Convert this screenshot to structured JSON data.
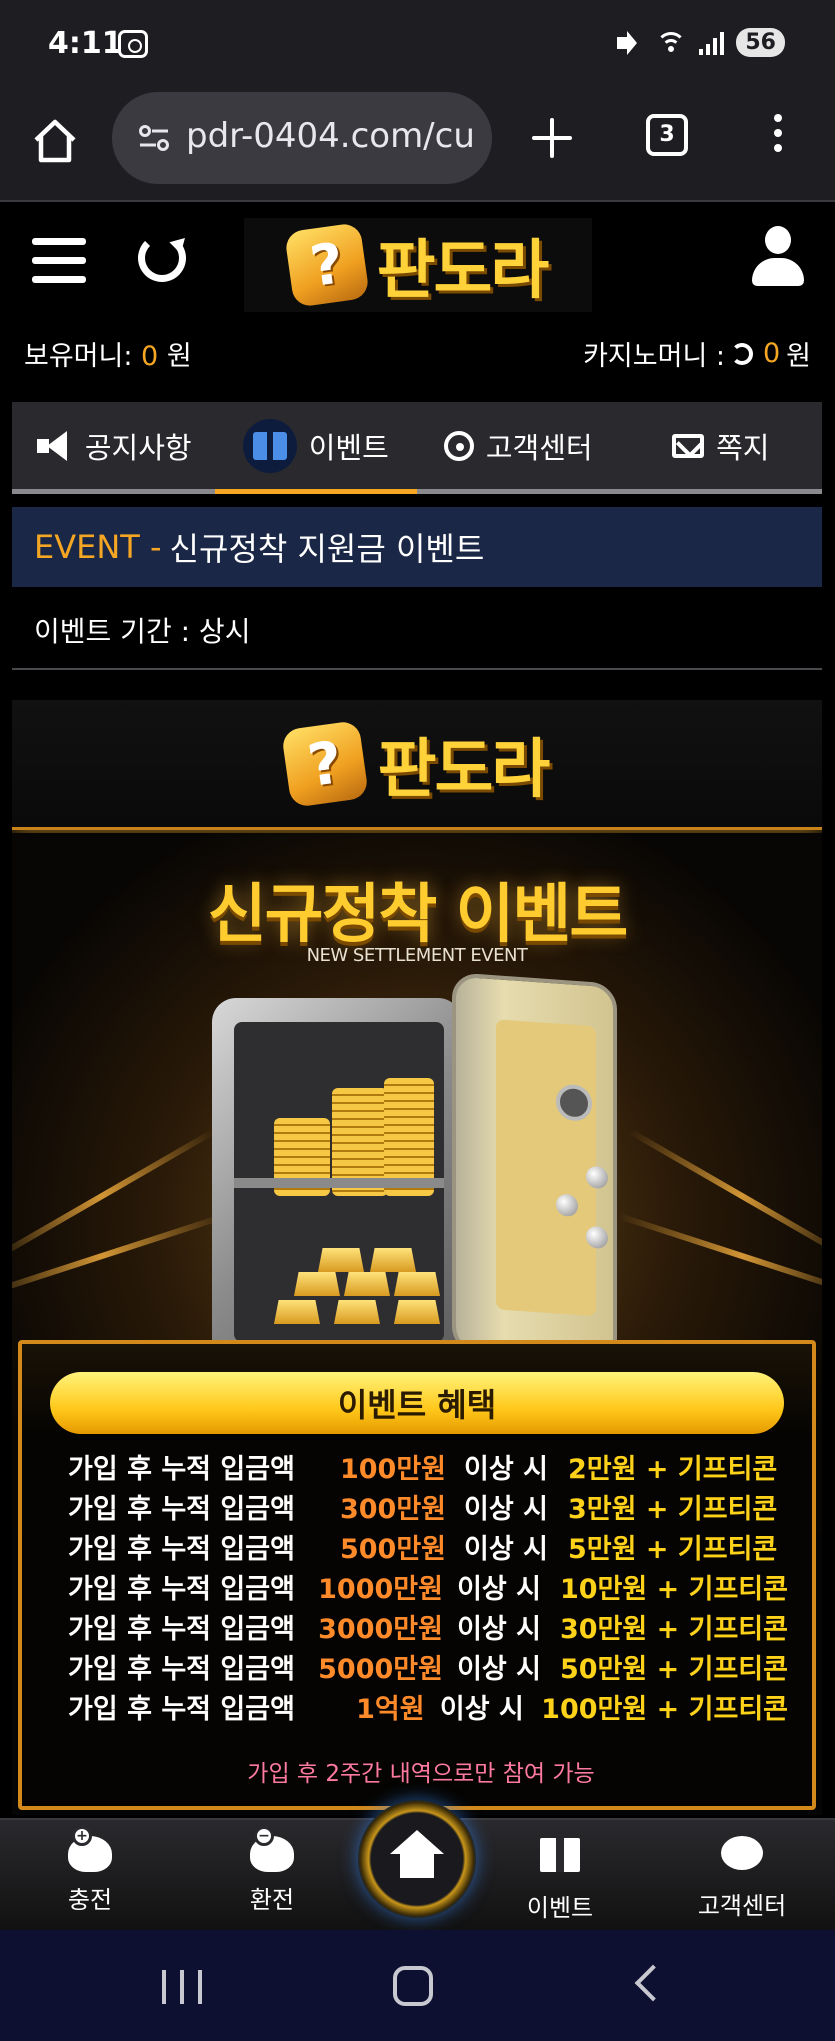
{
  "status_bar": {
    "time": "4:11",
    "battery": "56"
  },
  "browser": {
    "url": "pdr-0404.com/cu",
    "tab_count": "3"
  },
  "site": {
    "logo_text": "판도라",
    "logo_mark": "?",
    "money_label": "보유머니: ",
    "money_value": "0",
    "money_unit": " 원",
    "casino_label": "카지노머니 : ",
    "casino_value": "0",
    "casino_unit": " 원"
  },
  "tabs": [
    {
      "label": "공지사항",
      "icon": "megaphone-icon"
    },
    {
      "label": "이벤트",
      "icon": "gift-icon",
      "active": true
    },
    {
      "label": "고객센터",
      "icon": "headset-icon"
    },
    {
      "label": "쪽지",
      "icon": "mail-icon"
    }
  ],
  "event": {
    "prefix": "EVENT - ",
    "title": "신규정착 지원금 이벤트",
    "period": "이벤트 기간 : 상시"
  },
  "banner": {
    "logo_text": "판도라",
    "heading": "신규정착 이벤트",
    "subheading": "NEW SETTLEMENT EVENT",
    "benefits_title": "이벤트 혜택",
    "rows": [
      {
        "label": "가입 후 누적 입금액",
        "amount": "100만원",
        "cond": "이상 시",
        "reward": "2만원 + 기프티콘"
      },
      {
        "label": "가입 후 누적 입금액",
        "amount": "300만원",
        "cond": "이상 시",
        "reward": "3만원 + 기프티콘"
      },
      {
        "label": "가입 후 누적 입금액",
        "amount": "500만원",
        "cond": "이상 시",
        "reward": "5만원 + 기프티콘"
      },
      {
        "label": "가입 후 누적 입금액",
        "amount": "1000만원",
        "cond": "이상 시",
        "reward": "10만원 + 기프티콘"
      },
      {
        "label": "가입 후 누적 입금액",
        "amount": "3000만원",
        "cond": "이상 시",
        "reward": "30만원 + 기프티콘"
      },
      {
        "label": "가입 후 누적 입금액",
        "amount": "5000만원",
        "cond": "이상 시",
        "reward": "50만원 + 기프티콘"
      },
      {
        "label": "가입 후 누적 입금액",
        "amount": "1억원",
        "cond": "이상 시",
        "reward": "100만원 + 기프티콘"
      }
    ],
    "note": "가입 후 2주간 내역으로만 참여 가능"
  },
  "bottom_nav": [
    {
      "label": "충전",
      "icon": "deposit-icon"
    },
    {
      "label": "환전",
      "icon": "withdraw-icon"
    },
    {
      "label": "",
      "icon": "home-icon"
    },
    {
      "label": "이벤트",
      "icon": "gift-icon"
    },
    {
      "label": "고객센터",
      "icon": "chat-icon"
    }
  ],
  "colors": {
    "accent": "#f5a623",
    "gold": "#ffd21a",
    "amount": "#ff8a2a",
    "note": "#ff7aa0",
    "event_bar": "#1b2746"
  }
}
